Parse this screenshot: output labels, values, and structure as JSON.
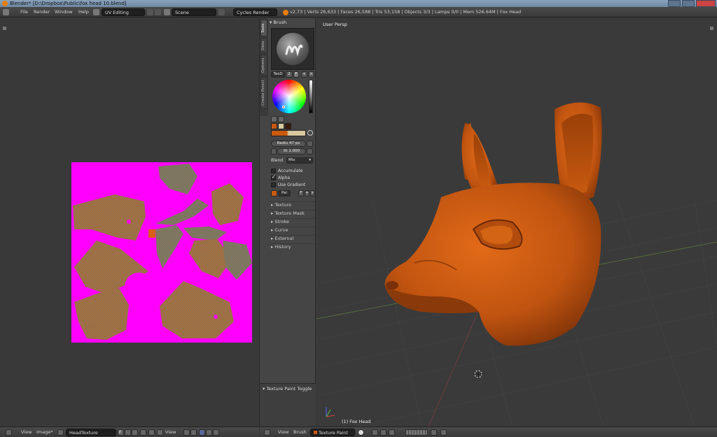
{
  "window": {
    "title": "Blender* [D:\\Dropbox\\Public\\fox head 10.blend]"
  },
  "menu": {
    "file": "File",
    "render": "Render",
    "window": "Window",
    "help": "Help"
  },
  "info": {
    "layout": "UV Editing",
    "scene": "Scene",
    "engine": "Cycles Render",
    "stats": "v2.73 | Verts 26,633 | Faces 26,588 | Tris 53,158 | Objects 3/3 | Lamps 0/0 | Mem 526.64M | Fox Head"
  },
  "brush_panel": {
    "header": "Brush",
    "brush_name": "TexD",
    "users": "2",
    "fake_user": "F",
    "radius_label": "Radiu",
    "radius_value": "47 px",
    "strength_label": "St",
    "strength_value": "1.000",
    "blend_label": "Blend",
    "blend_value": "Mix",
    "accumulate": "Accumulate",
    "alpha": "Alpha",
    "use_gradient": "Use Gradient",
    "palette": "Pal",
    "palette_f": "F"
  },
  "tabs": [
    "Tools",
    "Slots",
    "Options",
    "Create Pencil"
  ],
  "sections": [
    "Texture",
    "Texture Mask",
    "Stroke",
    "Curve",
    "External",
    "History"
  ],
  "texture_paint_toggle": "Texture Paint Toggle",
  "viewport": {
    "title": "User Persp",
    "object_label": "(1) Fox Head"
  },
  "image_footer": {
    "view": "View",
    "image": "Image*",
    "image_name": "HeadTexture",
    "f_label": "F",
    "view_mode": "View"
  },
  "viewport_footer": {
    "view": "View",
    "brush": "Brush",
    "mode": "Texture Paint"
  },
  "colors": {
    "uv_background": "#ff00ff",
    "fox_orange": "#c85a10",
    "island_gray": "#7a7a5a",
    "ui_bg": "#393939"
  }
}
